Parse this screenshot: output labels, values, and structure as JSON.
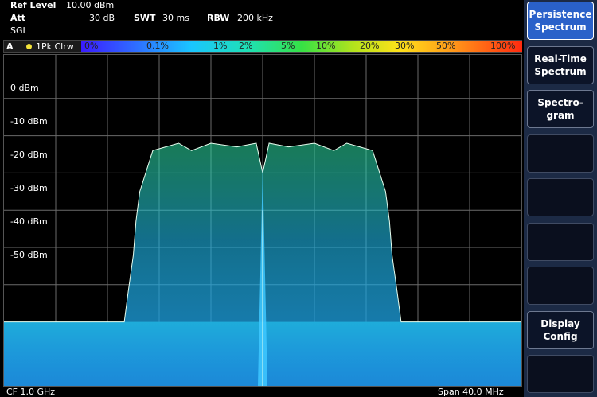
{
  "header": {
    "ref_level_label": "Ref Level",
    "ref_level_value": "10.00 dBm",
    "att_label": "Att",
    "att_value": "30 dB",
    "swt_label": "SWT",
    "swt_value": "30 ms",
    "rbw_label": "RBW",
    "rbw_value": "200 kHz",
    "mode": "SGL"
  },
  "trace": {
    "window_label": "A",
    "detector": "1Pk Clrw",
    "marker_color": "#f3e33a"
  },
  "persistence_scale": {
    "labels": [
      "0%",
      "0.1%",
      "1%",
      "2%",
      "5%",
      "10%",
      "20%",
      "30%",
      "50%",
      "100%"
    ]
  },
  "chart_data": {
    "type": "area",
    "title": "",
    "xlabel": "",
    "ylabel": "",
    "ylim": [
      -70,
      10
    ],
    "ytick_labels": [
      "0 dBm",
      "-10 dBm",
      "-20 dBm",
      "-30 dBm",
      "-40 dBm",
      "-50 dBm"
    ],
    "ytick_values": [
      0,
      -10,
      -20,
      -30,
      -40,
      -50
    ],
    "x_unit": "MHz offset from CF",
    "xlim": [
      -20,
      20
    ],
    "grid": true,
    "grid_divisions_x": 10,
    "series": [
      {
        "x": [
          -20,
          -10.7,
          -10.4,
          -10.0,
          -9.8,
          -9.5,
          -8.5,
          -7.5,
          -6.5,
          -5.5,
          -4,
          -2,
          -0.5,
          0,
          0.5,
          2,
          4,
          5.5,
          6.5,
          7.5,
          8.5,
          9.5,
          9.8,
          10.0,
          10.4,
          10.7,
          20
        ],
        "y": [
          -60,
          -60,
          -52,
          -42,
          -33,
          -25,
          -14,
          -13,
          -12,
          -14,
          -12,
          -13,
          -12,
          -20,
          -12,
          -13,
          -12,
          -14,
          -12,
          -13,
          -14,
          -25,
          -33,
          -42,
          -52,
          -60,
          -60
        ]
      }
    ],
    "center_carrier_dBm": -18,
    "noise_floor_dBm": -60
  },
  "footer": {
    "cf": "CF 1.0 GHz",
    "span": "Span 40.0 MHz"
  },
  "softkeys": [
    {
      "label1": "Persistence",
      "label2": "Spectrum",
      "state": "on"
    },
    {
      "label1": "Real-Time",
      "label2": "Spectrum",
      "state": "norm"
    },
    {
      "label1": "Spectro-",
      "label2": "gram",
      "state": "norm"
    },
    {
      "label1": "",
      "label2": "",
      "state": "blank"
    },
    {
      "label1": "",
      "label2": "",
      "state": "blank"
    },
    {
      "label1": "",
      "label2": "",
      "state": "blank"
    },
    {
      "label1": "",
      "label2": "",
      "state": "blank"
    },
    {
      "label1": "Display",
      "label2": "Config",
      "state": "norm"
    },
    {
      "label1": "",
      "label2": "",
      "state": "blank"
    }
  ]
}
